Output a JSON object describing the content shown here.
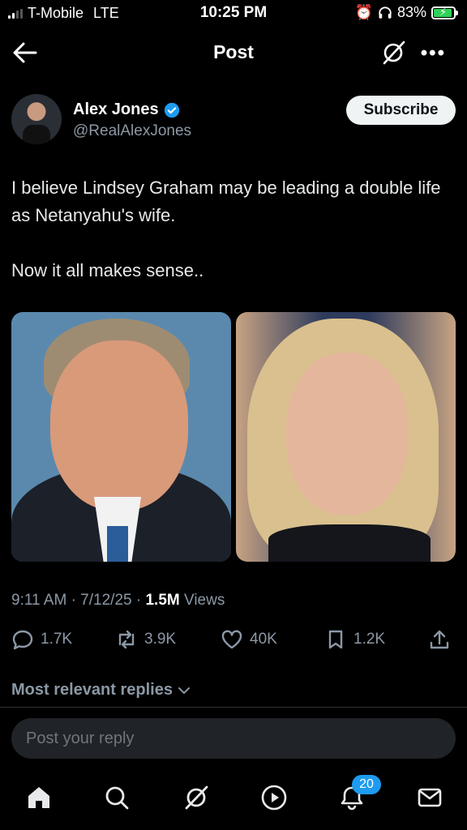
{
  "status_bar": {
    "carrier": "T-Mobile",
    "network": "LTE",
    "time": "10:25 PM",
    "battery_percent": "83%",
    "battery_level": 0.83,
    "icons": [
      "signal-bars",
      "alarm-icon",
      "headphones-icon",
      "battery-charging-icon"
    ]
  },
  "top_nav": {
    "title": "Post",
    "icons": [
      "back-arrow-icon",
      "grok-icon",
      "more-icon"
    ]
  },
  "post": {
    "author_name": "Alex Jones",
    "author_handle": "@RealAlexJones",
    "subscribe_label": "Subscribe",
    "text_line1": "I believe Lindsey Graham may be leading a double life as Netanyahu's wife.",
    "text_line2": "Now it all makes sense..",
    "meta_time": "9:11 AM · 7/12/25 · ",
    "meta_views_count": "1.5M",
    "meta_views_label": " Views",
    "actions": {
      "replies": "1.7K",
      "reposts": "3.9K",
      "likes": "40K",
      "bookmarks": "1.2K"
    }
  },
  "replies_header": "Most relevant replies",
  "reply_box": {
    "placeholder": "Post your reply"
  },
  "bottom_nav": {
    "items": [
      "home-icon",
      "search-icon",
      "grok-icon",
      "video-icon",
      "notifications-icon",
      "messages-icon"
    ],
    "notifications_badge": "20"
  },
  "colors": {
    "accent": "#1d9bf0",
    "background": "#000000",
    "muted_text": "#8b98a5",
    "battery_green": "#30d158"
  }
}
